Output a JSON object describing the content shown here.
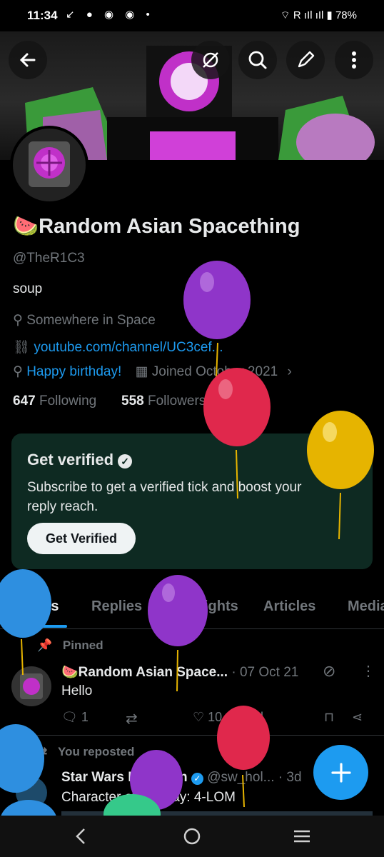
{
  "status_bar": {
    "time": "11:34",
    "battery": "78%",
    "notification_icons": [
      "missed-call-icon",
      "chat-icon",
      "discord-icon",
      "discord-icon",
      "dot-icon"
    ]
  },
  "profile": {
    "name": "🍉Random Asian Spacething",
    "handle": "@TheR1C3",
    "bio": "soup",
    "location": "Somewhere in Space",
    "website": "youtube.com/channel/UC3cef...",
    "birthday": "Happy birthday!",
    "joined": "Joined October 2021",
    "following_count": "647",
    "following_label": "Following",
    "followers_count": "558",
    "followers_label": "Followers"
  },
  "verify_card": {
    "title": "Get verified",
    "body_line1": "Subscribe to get a verified tick and boost your",
    "body_line2": "reply reach.",
    "button": "Get Verified"
  },
  "tabs": [
    "Posts",
    "Replies",
    "Highlights",
    "Articles",
    "Media"
  ],
  "pinned_post": {
    "pinned_label": "Pinned",
    "author": "🍉Random Asian Space...",
    "date": "· 07 Oct 21",
    "text": "Hello",
    "replies": "1",
    "likes": "10"
  },
  "repost": {
    "repost_label": "You reposted",
    "author": "Star Wars Holocron",
    "handle": "@sw_hol...",
    "time": "· 3d",
    "text": "Character of the Day: 4-LOM"
  },
  "colors": {
    "accent": "#1d9bf0",
    "background": "#000000",
    "verify_card_bg": "#0e2a22",
    "balloon_purple": "#8f35c9",
    "balloon_red": "#e0284c",
    "balloon_yellow": "#e6b400",
    "balloon_blue": "#2e8fe0",
    "balloon_green": "#35c98a"
  }
}
